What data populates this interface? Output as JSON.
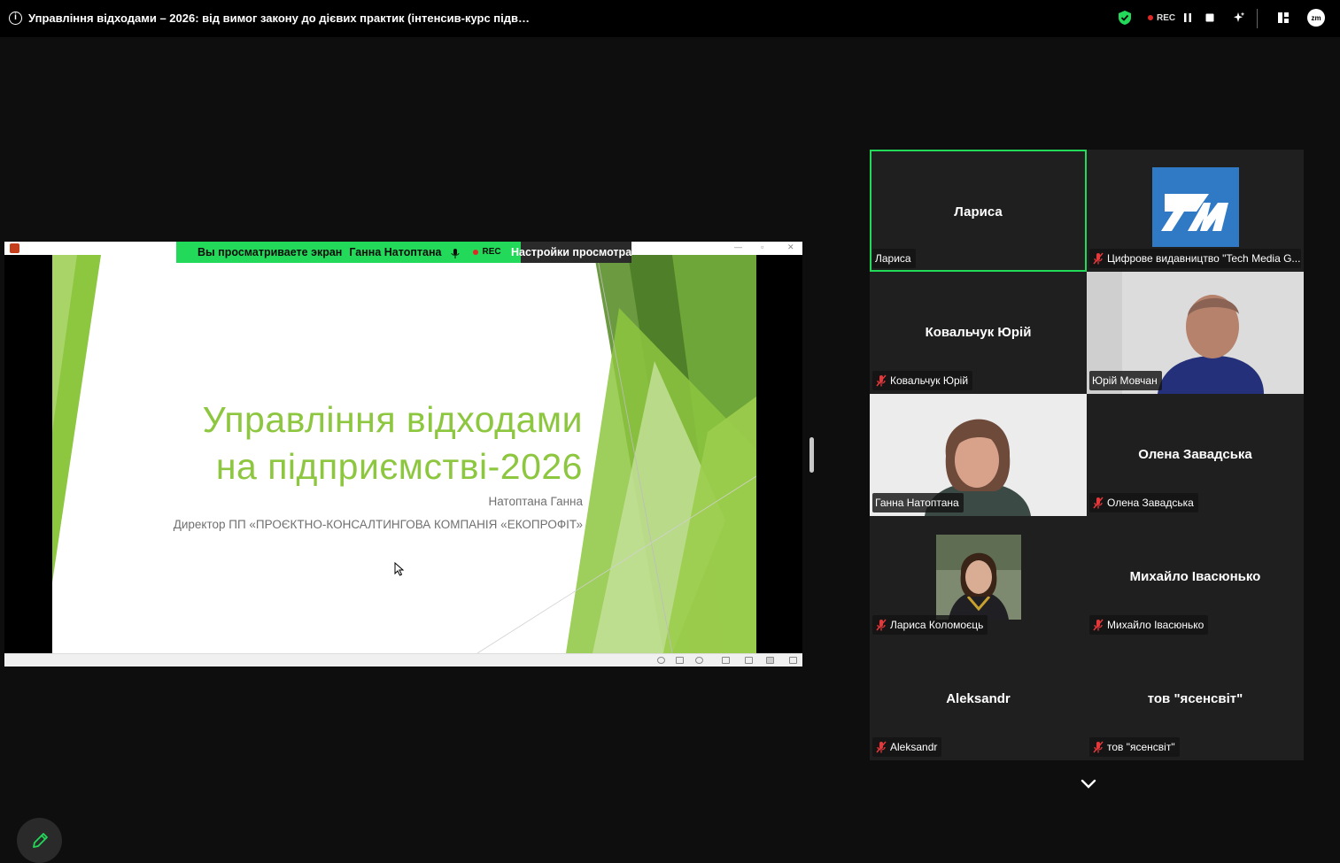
{
  "topbar": {
    "title": "Управління відходами – 2026: від вимог закону до дієвих практик (інтенсив-курс підвищенн...",
    "rec_label": "REC",
    "icons": [
      "info-icon",
      "shield-check-icon",
      "pause-icon",
      "stop-icon",
      "sparkle-icon",
      "layout-icon",
      "zoom-logo-icon"
    ],
    "zoom_logo": "zm"
  },
  "share": {
    "banner_text": "Вы просматриваете экран",
    "presenter": "Ганна Натоптана",
    "rec_label": "REC",
    "view_settings": "Настройки просмотра",
    "slide": {
      "title_line1": "Управління відходами",
      "title_line2": "на підприємстві-2026",
      "author": "Натоптана Ганна",
      "position": "Директор ПП «ПРОЄКТНО-КОНСАЛТИНГОВА КОМПАНІЯ «ЕКОПРОФІТ»",
      "accent_color": "#8dc63f"
    }
  },
  "participants": [
    {
      "big_name": "Лариса",
      "label": "Лариса",
      "muted": false,
      "active": true,
      "media": "name"
    },
    {
      "big_name": "",
      "label": "Цифрове видавництво \"Tech Media G...",
      "muted": true,
      "active": false,
      "media": "tm-logo"
    },
    {
      "big_name": "Ковальчук Юрій",
      "label": "Ковальчук Юрій",
      "muted": true,
      "active": false,
      "media": "name"
    },
    {
      "big_name": "",
      "label": "Юрій Мовчан",
      "muted": false,
      "active": false,
      "media": "video-man"
    },
    {
      "big_name": "",
      "label": "Ганна Натоптана",
      "muted": false,
      "active": false,
      "media": "video-woman"
    },
    {
      "big_name": "Олена Завадська",
      "label": "Олена Завадська",
      "muted": true,
      "active": false,
      "media": "name"
    },
    {
      "big_name": "",
      "label": "Лариса Коломоєць",
      "muted": true,
      "active": false,
      "media": "avatar-photo"
    },
    {
      "big_name": "Михайло Івасюнько",
      "label": "Михайло Івасюнько",
      "muted": true,
      "active": false,
      "media": "name"
    },
    {
      "big_name": "Aleksandr",
      "label": "Aleksandr",
      "muted": true,
      "active": false,
      "media": "name"
    },
    {
      "big_name": "тов \"ясенсвіт\"",
      "label": "тов \"ясенсвіт\"",
      "muted": true,
      "active": false,
      "media": "name"
    }
  ],
  "colors": {
    "active_border": "#23d959",
    "banner_green": "#23d959",
    "muted_mic": "#e5383b",
    "tile_bg": "#1f1f1f"
  }
}
